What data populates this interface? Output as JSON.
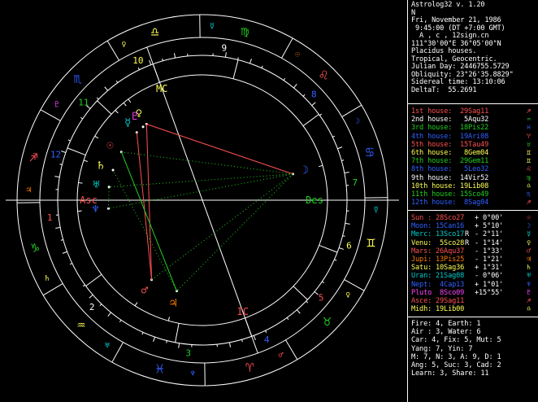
{
  "colors": {
    "red": "#ff5050",
    "orange": "#ff7a00",
    "yellow": "#ffff55",
    "green": "#20d020",
    "cyan": "#00cccc",
    "blue": "#3060ff",
    "magenta": "#ff44ff",
    "gray": "#c0c0c0",
    "white": "#ffffff",
    "brightgreen": "#30ff30"
  },
  "info": {
    "title": "Astrolog32 v. 1.20",
    "name": "N",
    "date": "Fri, November 21, 1986",
    "time": " 9:45:00 (DT +7:00 GMT)",
    "place": "  A , c , 12sign.cn",
    "coords": "111°30'00\"E 36°05'00\"N",
    "houses": "Placidus houses.",
    "zodiac": "Tropical, Geocentric.",
    "julian": "Julian Day: 2446755.5729",
    "obliquity": "Obliquity: 23°26'35.8829\"",
    "sidereal": "Sidereal time: 13:10:06",
    "deltat": "DeltaT:  55.2691"
  },
  "house_cusps": [
    {
      "label": "1st house:",
      "value": "29Sag11",
      "color": "red",
      "glyph": "♐",
      "glyph_color": "red"
    },
    {
      "label": "2nd house:",
      "value": " 5Aqu32",
      "color": "white",
      "glyph": "♒",
      "glyph_color": "green"
    },
    {
      "label": "3rd house:",
      "value": "18Pis22",
      "color": "green",
      "glyph": "♓",
      "glyph_color": "blue"
    },
    {
      "label": "4th house:",
      "value": "19Ari08",
      "color": "blue",
      "glyph": "♈",
      "glyph_color": "red"
    },
    {
      "label": "5th house:",
      "value": "15Tau49",
      "color": "red",
      "glyph": "♉",
      "glyph_color": "green"
    },
    {
      "label": "6th house:",
      "value": " 8Gem04",
      "color": "yellow",
      "glyph": "♊",
      "glyph_color": "yellow"
    },
    {
      "label": "7th house:",
      "value": "29Gem11",
      "color": "green",
      "glyph": "♊",
      "glyph_color": "yellow"
    },
    {
      "label": "8th house:",
      "value": " 5Leo32",
      "color": "blue",
      "glyph": "♌",
      "glyph_color": "red"
    },
    {
      "label": "9th house:",
      "value": "14Vir52",
      "color": "white",
      "glyph": "♍",
      "glyph_color": "green"
    },
    {
      "label": "10th house:",
      "value": "19Lib08",
      "color": "yellow",
      "glyph": "♎",
      "glyph_color": "yellow"
    },
    {
      "label": "11th house:",
      "value": "15Sco49",
      "color": "green",
      "glyph": "♏",
      "glyph_color": "blue"
    },
    {
      "label": "12th house:",
      "value": " 8Sag04",
      "color": "blue",
      "glyph": "♐",
      "glyph_color": "red"
    }
  ],
  "planets": [
    {
      "name": "Sun :",
      "pos": "28Sco27",
      "retro": " ",
      "lat": "+ 0°00'",
      "color": "red",
      "glyph": "☉"
    },
    {
      "name": "Moon:",
      "pos": "15Can16",
      "retro": " ",
      "lat": "+ 5°10'",
      "color": "blue",
      "glyph": "☽"
    },
    {
      "name": "Merc:",
      "pos": "13Sco17",
      "retro": "R",
      "lat": "- 2°11'",
      "color": "cyan",
      "glyph": "☿"
    },
    {
      "name": "Venu:",
      "pos": " 5Sco28",
      "retro": "R",
      "lat": "- 1°14'",
      "color": "yellow",
      "glyph": "♀"
    },
    {
      "name": "Mars:",
      "pos": "26Aqu37",
      "retro": " ",
      "lat": "- 1°33'",
      "color": "red",
      "glyph": "♂"
    },
    {
      "name": "Jupi:",
      "pos": "13Pis25",
      "retro": " ",
      "lat": "- 1°21'",
      "color": "orange",
      "glyph": "♃"
    },
    {
      "name": "Satu:",
      "pos": "10Sag36",
      "retro": " ",
      "lat": "+ 1°31'",
      "color": "yellow",
      "glyph": "♄"
    },
    {
      "name": "Uran:",
      "pos": "21Sag08",
      "retro": " ",
      "lat": "- 0°06'",
      "color": "cyan",
      "glyph": "♅"
    },
    {
      "name": "Nept:",
      "pos": " 4Cap13",
      "retro": " ",
      "lat": "+ 1°01'",
      "color": "blue",
      "glyph": "♆"
    },
    {
      "name": "Pluto",
      "pos": " 8Sco09",
      "retro": " ",
      "lat": "+15°55'",
      "color": "magenta",
      "glyph": "♇"
    },
    {
      "name": "Asce:",
      "pos": "29Sag11",
      "retro": " ",
      "lat": "",
      "color": "red",
      "glyph": "♐"
    },
    {
      "name": "Midh:",
      "pos": "19Lib00",
      "retro": " ",
      "lat": "",
      "color": "yellow",
      "glyph": "♎"
    }
  ],
  "stats": [
    "Fire: 4, Earth: 1",
    "Air : 3, Water: 6",
    "Car: 4, Fix: 5, Mut: 5",
    "Yang: 7, Yin: 7",
    "M: 7, N: 3, A: 9, D: 1",
    "Ang: 5, Suc: 3, Cad: 2",
    "Learn: 3, Share: 11"
  ],
  "wheel": {
    "signs": [
      {
        "glyph": "♈",
        "color": "red"
      },
      {
        "glyph": "♉",
        "color": "green"
      },
      {
        "glyph": "♊",
        "color": "yellow"
      },
      {
        "glyph": "♋",
        "color": "blue"
      },
      {
        "glyph": "♌",
        "color": "red"
      },
      {
        "glyph": "♍",
        "color": "green"
      },
      {
        "glyph": "♎",
        "color": "yellow"
      },
      {
        "glyph": "♏",
        "color": "blue"
      },
      {
        "glyph": "♐",
        "color": "red"
      },
      {
        "glyph": "♑",
        "color": "green"
      },
      {
        "glyph": "♒",
        "color": "yellow"
      },
      {
        "glyph": "♓",
        "color": "blue"
      }
    ],
    "sign_rulers": [
      {
        "glyph": "♂",
        "color": "red"
      },
      {
        "glyph": "♀",
        "color": "yellow"
      },
      {
        "glyph": "☿",
        "color": "cyan"
      },
      {
        "glyph": "☽",
        "color": "blue"
      },
      {
        "glyph": "☉",
        "color": "orange"
      },
      {
        "glyph": "☿",
        "color": "cyan"
      },
      {
        "glyph": "♀",
        "color": "yellow"
      },
      {
        "glyph": "♇",
        "color": "magenta"
      },
      {
        "glyph": "♃",
        "color": "orange"
      },
      {
        "glyph": "♄",
        "color": "yellow"
      },
      {
        "glyph": "♅",
        "color": "cyan"
      },
      {
        "glyph": "♆",
        "color": "blue"
      }
    ],
    "house_numbers": [
      "1",
      "2",
      "3",
      "4",
      "5",
      "6",
      "7",
      "8",
      "9",
      "10",
      "11",
      "12"
    ],
    "house_number_colors": [
      "red",
      "white",
      "green",
      "blue",
      "red",
      "yellow",
      "green",
      "blue",
      "white",
      "yellow",
      "green",
      "blue"
    ],
    "angle_labels": {
      "asc": "Asc",
      "des": "Des",
      "mc": "MC",
      "ic": "IC"
    },
    "placements": [
      {
        "glyph": "♀",
        "color": "yellow",
        "deg": 215.47
      },
      {
        "glyph": "♇",
        "color": "magenta",
        "deg": 218.15
      },
      {
        "glyph": "☿",
        "color": "cyan",
        "deg": 223.28
      },
      {
        "glyph": "☉",
        "color": "red",
        "deg": 238.45
      },
      {
        "glyph": "♄",
        "color": "yellow",
        "deg": 250.6
      },
      {
        "glyph": "♅",
        "color": "cyan",
        "deg": 261.13
      },
      {
        "glyph": "♆",
        "color": "blue",
        "deg": 274.22
      },
      {
        "glyph": "♂",
        "color": "red",
        "deg": 326.62
      },
      {
        "glyph": "♃",
        "color": "orange",
        "deg": 343.42
      },
      {
        "glyph": "☽",
        "color": "blue",
        "deg": 105.27
      }
    ]
  }
}
